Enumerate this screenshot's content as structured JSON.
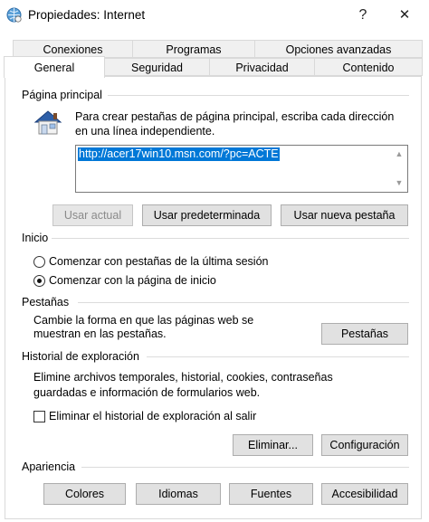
{
  "window": {
    "title": "Propiedades: Internet",
    "help_symbol": "?",
    "close_symbol": "✕"
  },
  "tabs_row1": [
    "Conexiones",
    "Programas",
    "Opciones avanzadas"
  ],
  "tabs_row2": [
    "General",
    "Seguridad",
    "Privacidad",
    "Contenido"
  ],
  "active_tab": "General",
  "home_page": {
    "heading": "Página principal",
    "description_line1": "Para crear pestañas de página principal, escriba cada dirección",
    "description_line2": "en una línea independiente.",
    "url_value": "http://acer17win10.msn.com/?pc=ACTE",
    "use_current": "Usar actual",
    "use_default": "Usar predeterminada",
    "use_new_tab": "Usar nueva pestaña"
  },
  "startup": {
    "heading": "Inicio",
    "option_tabs": "Comenzar con pestañas de la última sesión",
    "option_home": "Comenzar con la página de inicio",
    "selected": "home"
  },
  "tabs_section": {
    "heading": "Pestañas",
    "description_line1": "Cambie la forma en que las páginas web se",
    "description_line2": "muestran en las pestañas.",
    "button": "Pestañas"
  },
  "history": {
    "heading": "Historial de exploración",
    "description_line1": "Elimine archivos temporales, historial, cookies, contraseñas",
    "description_line2": "guardadas e información de formularios web.",
    "checkbox_label": "Eliminar el historial de exploración al salir",
    "checkbox_checked": false,
    "delete_button": "Eliminar...",
    "settings_button": "Configuración"
  },
  "appearance": {
    "heading": "Apariencia",
    "colors": "Colores",
    "languages": "Idiomas",
    "fonts": "Fuentes",
    "accessibility": "Accesibilidad"
  }
}
